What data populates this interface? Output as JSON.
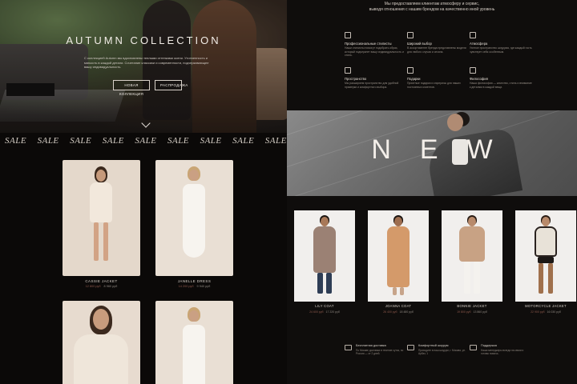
{
  "hero": {
    "title": "AUTUMN COLLECTION",
    "text": "С коллекцией Autumn мы вдохновлены теплыми оттенками осени. Утонченность и мягкость в каждой детали. Сочетание классики и современности, подчеркивающее вашу индивидуальность.",
    "button_new": "НОВАЯ КОЛЛЕКЦИЯ",
    "button_sale": "РАСПРОДАЖА"
  },
  "sale_strip": [
    "SALE",
    "SALE",
    "SALE",
    "SALE",
    "SALE",
    "SALE",
    "SALE",
    "SALE",
    "SALE"
  ],
  "left_products": [
    {
      "name": "CASSIE JACKET",
      "old_price": "12 800 руб",
      "price": "8 960 руб"
    },
    {
      "name": "JANELLE DRESS",
      "old_price": "14 200 руб",
      "price": "9 940 руб"
    },
    {
      "name": "",
      "old_price": "",
      "price": ""
    },
    {
      "name": "",
      "old_price": "",
      "price": ""
    }
  ],
  "right": {
    "intro_line1": "Мы предоставляем клиентам атмосферу и сервис,",
    "intro_line2": "выводя отношения с нашим брендом на качественно иной уровень",
    "features": [
      {
        "title": "Профессиональные стилисты",
        "text": "Наши стилисты помогут подобрать образ, который подчеркнет вашу индивидуальность и стиль."
      },
      {
        "title": "Широкий выбор",
        "text": "В ассортименте бренда представлены модели для любого случая и сезона."
      },
      {
        "title": "Атмосфера",
        "text": "Уютное пространство шоурума, где каждый гость чувствует себя особенным."
      },
      {
        "title": "Пространство",
        "text": "Мы расширяем пространство для удобной примерки и комфортного выбора."
      },
      {
        "title": "Подарки",
        "text": "Приятные подарки и сюрпризы для наших постоянных клиентов."
      },
      {
        "title": "Философия",
        "text": "Наша философия — качество, стиль и внимание к деталям в каждой вещи."
      }
    ],
    "new_banner": "NEW",
    "products": [
      {
        "name": "LILY COAT",
        "old_price": "24 600 руб",
        "price": "17 220 руб"
      },
      {
        "name": "JOANNA COAT",
        "old_price": "26 400 руб",
        "price": "18 480 руб"
      },
      {
        "name": "BONNIE JACKET",
        "old_price": "19 800 руб",
        "price": "13 860 руб"
      },
      {
        "name": "MOTORCYCLE JACKET",
        "old_price": "22 900 руб",
        "price": "16 030 руб"
      }
    ],
    "services": [
      {
        "title": "Бесплатная доставка",
        "text": "По Москве доставка в течение суток, по России — от 2 дней."
      },
      {
        "title": "Комфортный шоурум",
        "text": "Приходите в наш шоурум, г. Москва, ул. Арбат, 1"
      },
      {
        "title": "Поддержка",
        "text": "Наши менеджеры всегда на связи и готовы помочь."
      }
    ]
  }
}
